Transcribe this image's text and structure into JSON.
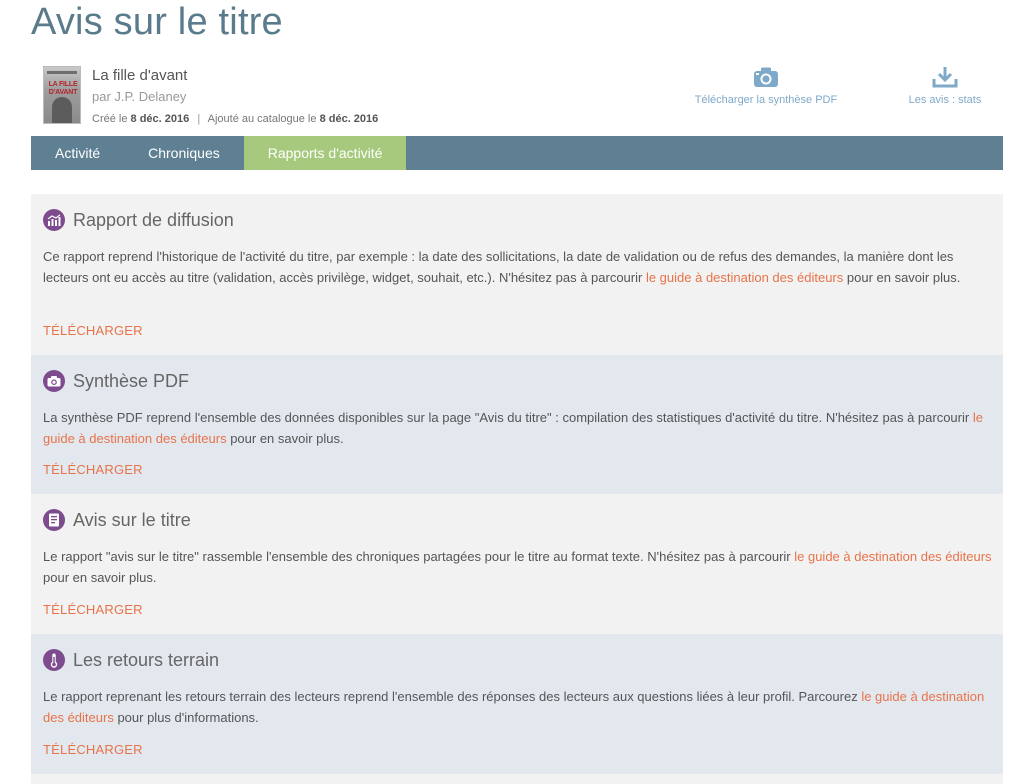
{
  "page": {
    "title": "Avis sur le titre"
  },
  "book": {
    "title": "La fille d'avant",
    "author": "par J.P. Delaney",
    "cover_text": "LA FILLE D'AVANT",
    "created_label": "Créé le",
    "created_date": "8 déc. 2016",
    "separator": "|",
    "added_label": "Ajouté au catalogue le",
    "added_date": "8 déc. 2016"
  },
  "actions": {
    "pdf": {
      "label": "Télécharger la synthèse PDF",
      "icon": "camera-icon"
    },
    "stats": {
      "label": "Les avis : stats",
      "icon": "download-icon"
    }
  },
  "tabs": [
    {
      "label": "Activité",
      "active": false
    },
    {
      "label": "Chroniques",
      "active": false
    },
    {
      "label": "Rapports d'activité",
      "active": true
    }
  ],
  "sections": [
    {
      "title": "Rapport de diffusion",
      "icon": "chart-icon",
      "text_before": "Ce rapport reprend l'historique de l'activité du titre, par exemple : la date des sollicitations, la date de validation ou de refus des demandes, la manière dont les lecteurs ont eu accès au titre (validation, accès privilège, widget, souhait, etc.). N'hésitez pas à parcourir ",
      "link": "le guide à destination des éditeurs",
      "text_after": " pour en savoir plus.",
      "download": "TÉLÉCHARGER"
    },
    {
      "title": "Synthèse PDF",
      "icon": "camera-icon",
      "text_before": "La synthèse PDF reprend l'ensemble des données disponibles sur la page \"Avis du titre\" : compilation des statistiques d'activité du titre. N'hésitez pas à parcourir ",
      "link": "le guide à destination des éditeurs",
      "text_after": " pour en savoir plus.",
      "download": "TÉLÉCHARGER"
    },
    {
      "title": "Avis sur le titre",
      "icon": "document-icon",
      "text_before": "Le rapport \"avis sur le titre\" rassemble l'ensemble des chroniques partagées pour le titre au format texte. N'hésitez pas à parcourir ",
      "link": "le guide à destination des éditeurs",
      "text_after": " pour en savoir plus.",
      "download": "TÉLÉCHARGER"
    },
    {
      "title": "Les retours terrain",
      "icon": "thermometer-icon",
      "text_before": "Le rapport reprenant les retours terrain des lecteurs reprend l'ensemble des réponses des lecteurs aux questions liées à leur profil. Parcourez ",
      "link": "le guide à destination des éditeurs",
      "text_after": " pour plus d'informations.",
      "download": "TÉLÉCHARGER"
    }
  ],
  "colors": {
    "title": "#5a7b8c",
    "tabbar": "#5f8093",
    "tab_active": "#a6c97d",
    "accent_link": "#e8734a",
    "icon_purple": "#7e4c8e",
    "action_blue": "#7fa9c9"
  }
}
